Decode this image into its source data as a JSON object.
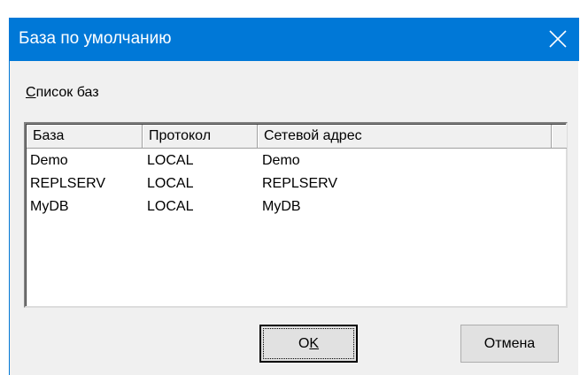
{
  "window": {
    "title": "База по умолчанию"
  },
  "group": {
    "label_prefix": "С",
    "label_rest": "писок баз"
  },
  "list": {
    "columns": [
      "База",
      "Протокол",
      "Сетевой адрес"
    ],
    "rows": [
      [
        "Demo",
        "LOCAL",
        "Demo"
      ],
      [
        "REPLSERV",
        "LOCAL",
        "REPLSERV"
      ],
      [
        "MyDB",
        "LOCAL",
        "MyDB"
      ]
    ]
  },
  "buttons": {
    "ok_prefix": "O",
    "ok_underlined": "K",
    "cancel": "Отмена"
  },
  "colors": {
    "titlebar": "#0078d7",
    "face": "#f0f0f0"
  },
  "icons": {
    "close": "close-icon"
  }
}
